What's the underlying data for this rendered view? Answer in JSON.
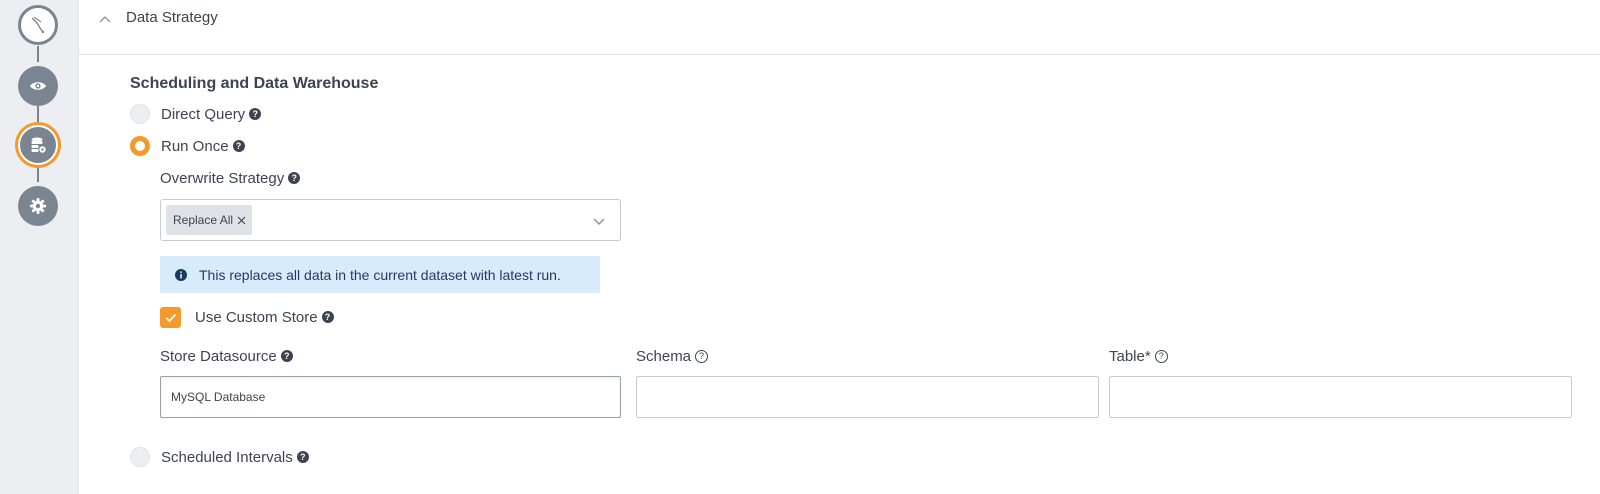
{
  "section": {
    "title": "Data Strategy"
  },
  "group": {
    "title": "Scheduling and Data Warehouse"
  },
  "options": {
    "direct_query": "Direct Query",
    "run_once": "Run Once",
    "scheduled_intervals": "Scheduled Intervals",
    "selected": "run_once"
  },
  "overwrite": {
    "label": "Overwrite Strategy",
    "selected_chip": "Replace All",
    "info": "This replaces all data in the current dataset with latest run."
  },
  "custom_store": {
    "label": "Use Custom Store",
    "checked": true
  },
  "fields": {
    "datasource_label": "Store Datasource",
    "datasource_value": "MySQL Database",
    "schema_label": "Schema",
    "schema_value": "",
    "table_label": "Table*",
    "table_value": ""
  },
  "rail": {
    "steps": [
      "source-icon",
      "preview-icon",
      "data-strategy-icon",
      "settings-icon"
    ],
    "active_step": 2
  },
  "colors": {
    "accent": "#f39a2b",
    "info_bg": "#d8ebfb",
    "rail_bg": "#eceef1",
    "step": "#7a8591"
  }
}
